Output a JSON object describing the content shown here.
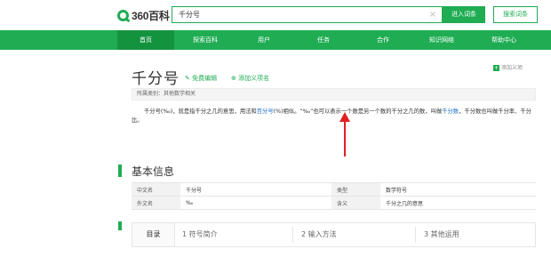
{
  "header": {
    "logo_text": "360百科",
    "search_value": "千分号",
    "clear_glyph": "×",
    "enter_label": "进入词条",
    "search_label": "搜索词条"
  },
  "nav": {
    "items": [
      {
        "label": "首页",
        "active": true
      },
      {
        "label": "探索百科"
      },
      {
        "label": "用户"
      },
      {
        "label": "任务"
      },
      {
        "label": "合作"
      },
      {
        "label": "知识网络"
      },
      {
        "label": "帮助中心"
      }
    ]
  },
  "entry": {
    "title": "千分号",
    "edit_label": "免费编辑",
    "add_sense_label": "添加义项名",
    "side_add_label": "添加义项",
    "category": "所属类别：其他数学相关",
    "summary_part1": "千分号(‰)，就是指千分之几的意思，用法和",
    "summary_link1": "百分号",
    "summary_part2": "(%)相似。“‰”也可以表示一个数是另一个数的千分之几的数，叫做",
    "summary_link2": "千分数",
    "summary_part3": "，千分数也叫做千分率、千分比。"
  },
  "basic_info": {
    "section_title": "基本信息",
    "rows": [
      [
        "中文名",
        "千分号",
        "类型",
        "数学符号"
      ],
      [
        "外文名",
        "‰",
        "含义",
        "千分之几的意思"
      ]
    ]
  },
  "toc": {
    "head": "目录",
    "items": [
      "1 符号简介",
      "2 输入方法",
      "3 其他运用"
    ]
  },
  "colors": {
    "brand_green": "#1fac53",
    "link_blue": "#1a6ec5",
    "annotation_red": "#e02020"
  }
}
